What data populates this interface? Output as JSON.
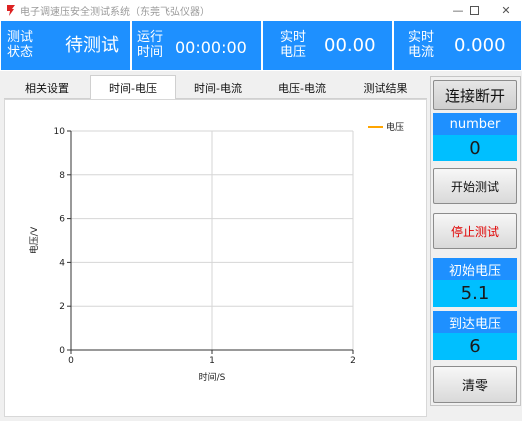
{
  "window": {
    "title": "电子调速压安全测试系统（东莞飞弘仪器）",
    "minimize_icon": "minimize-icon",
    "maximize_icon": "maximize-icon",
    "close_icon": "close-icon"
  },
  "status": {
    "test_state_label": "测试\n状态",
    "test_state_value": "待测试",
    "run_time_label": "运行\n时间",
    "run_time_value": "00:00:00",
    "voltage_label": "实时\n电压",
    "voltage_value": "00.00",
    "current_label": "实时\n电流",
    "current_value": "0.000"
  },
  "tabs": [
    {
      "label": "相关设置"
    },
    {
      "label": "时间-电压"
    },
    {
      "label": "时间-电流"
    },
    {
      "label": "电压-电流"
    },
    {
      "label": "测试结果"
    }
  ],
  "active_tab": 1,
  "chart_data": {
    "type": "line",
    "xlabel": "时间/S",
    "ylabel": "电压/V",
    "xlim": [
      0,
      2
    ],
    "ylim": [
      0,
      10
    ],
    "x_ticks": [
      "0",
      "1",
      "2"
    ],
    "y_ticks": [
      "0",
      "2",
      "4",
      "6",
      "8",
      "10"
    ],
    "grid": true,
    "legend_position": "top-right",
    "series": [
      {
        "name": "电压",
        "x": [],
        "y": [],
        "color": "#ffa500"
      }
    ]
  },
  "side": {
    "connect_label": "连接断开",
    "number_label": "number",
    "number_value": "0",
    "start_label": "开始测试",
    "stop_label": "停止测试",
    "init_voltage_label": "初始电压",
    "init_voltage_value": "5.1",
    "target_voltage_label": "到达电压",
    "target_voltage_value": "6",
    "clear_label": "清零"
  },
  "colors": {
    "header_blue": "#1e90ff",
    "value_cyan": "#00bfff",
    "stop_red": "#e00000",
    "series_orange": "#ffa500"
  }
}
